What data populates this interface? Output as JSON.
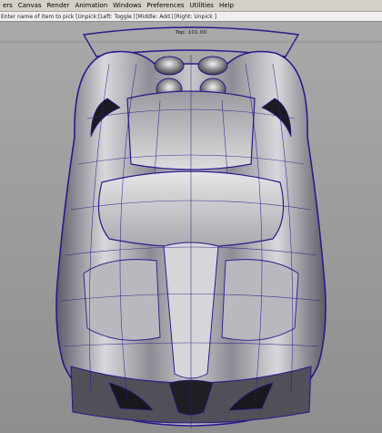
{
  "menu": {
    "items": [
      "ers",
      "Canvas",
      "Render",
      "Animation",
      "Windows",
      "Preferences",
      "Utilities",
      "Help"
    ]
  },
  "prompt": {
    "text": "Enter name of item to pick [Unpick:",
    "left_hint": "[Left: Toggle",
    "middle_hint": "[Middle: Add",
    "right_hint": "[Right: Unpick ]"
  },
  "viewport": {
    "title": "Top: 101.00",
    "background": "#9a9a9a",
    "wire_color": "#2a1a8c",
    "object": "sports-car-top-view"
  }
}
